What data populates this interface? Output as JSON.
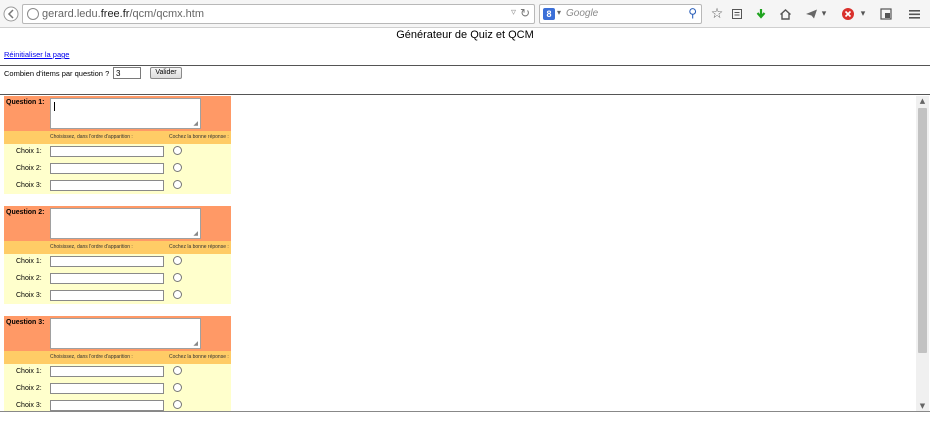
{
  "browser": {
    "url_prefix": "gerard.ledu.",
    "url_domain": "free.fr",
    "url_path": "/qcm/qcmx.htm",
    "search_engine_badge": "8",
    "search_placeholder": "Google"
  },
  "page": {
    "title": "Générateur de Quiz et QCM",
    "reset_link": "Réinitialiser la page",
    "items_label": "Combien d'items par question ?",
    "items_value": "3",
    "validate_label": "Valider"
  },
  "questions": [
    {
      "label": "Question 1:",
      "sub_left": "Choisissez, dans l'ordre d'apparition :",
      "sub_right": "Cochez la bonne réponse :",
      "choices": [
        "Choix 1:",
        "Choix 2:",
        "Choix 3:"
      ]
    },
    {
      "label": "Question 2:",
      "sub_left": "Choisissez, dans l'ordre d'apparition :",
      "sub_right": "Cochez la bonne réponse :",
      "choices": [
        "Choix 1:",
        "Choix 2:",
        "Choix 3:"
      ]
    },
    {
      "label": "Question 3:",
      "sub_left": "Choisissez, dans l'ordre d'apparition :",
      "sub_right": "Cochez la bonne réponse :",
      "choices": [
        "Choix 1:",
        "Choix 2:",
        "Choix 3:"
      ]
    }
  ],
  "colors": {
    "question_header": "#ff9966",
    "instruction_bar": "#ffcc66",
    "choices_bg": "#ffffcc",
    "link": "#0000ee"
  },
  "icons": [
    "back-icon",
    "globe-icon",
    "dropdown-arrow-icon",
    "reload-icon",
    "search-engine-icon",
    "search-icon",
    "bookmark-star-icon",
    "reading-list-icon",
    "download-icon",
    "home-icon",
    "send-icon",
    "menu-dropdown-icon",
    "addon-block-icon",
    "addon-dropdown-icon",
    "window-icon",
    "hamburger-menu-icon",
    "textarea-resize-icon",
    "radio-icon",
    "scroll-up-icon",
    "scroll-down-icon"
  ]
}
